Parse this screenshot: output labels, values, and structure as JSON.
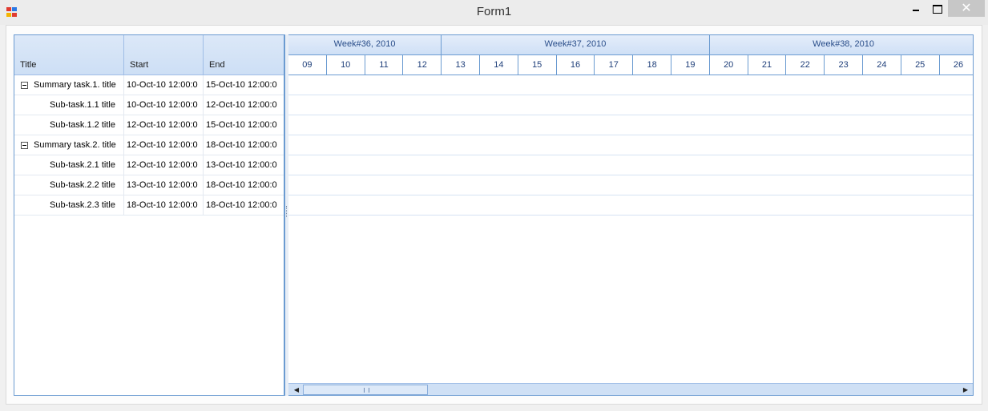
{
  "window": {
    "title": "Form1",
    "close_glyph": "✕"
  },
  "grid": {
    "columns": [
      "Title",
      "Start",
      "End"
    ],
    "rows": [
      {
        "title": "Summary task.1. title",
        "start": "10-Oct-10 12:00:0",
        "end": "15-Oct-10 12:00:0",
        "summary": true
      },
      {
        "title": "Sub-task.1.1 title",
        "start": "10-Oct-10 12:00:0",
        "end": "12-Oct-10 12:00:0",
        "summary": false
      },
      {
        "title": "Sub-task.1.2 title",
        "start": "12-Oct-10 12:00:0",
        "end": "15-Oct-10 12:00:0",
        "summary": false
      },
      {
        "title": "Summary task.2. title",
        "start": "12-Oct-10 12:00:0",
        "end": "18-Oct-10 12:00:0",
        "summary": true
      },
      {
        "title": "Sub-task.2.1 title",
        "start": "12-Oct-10 12:00:0",
        "end": "13-Oct-10 12:00:0",
        "summary": false
      },
      {
        "title": "Sub-task.2.2 title",
        "start": "13-Oct-10 12:00:0",
        "end": "18-Oct-10 12:00:0",
        "summary": false
      },
      {
        "title": "Sub-task.2.3 title",
        "start": "18-Oct-10 12:00:0",
        "end": "18-Oct-10 12:00:0",
        "summary": false
      }
    ]
  },
  "timeline": {
    "weeks": [
      "Week#36, 2010",
      "Week#37, 2010",
      "Week#38, 2010"
    ],
    "days": [
      "09",
      "10",
      "11",
      "12",
      "13",
      "14",
      "15",
      "16",
      "17",
      "18",
      "19",
      "20",
      "21",
      "22",
      "23",
      "24",
      "25",
      "26"
    ],
    "week_day_counts": [
      4,
      7,
      7
    ]
  },
  "scrollbar": {
    "left_arrow": "◀",
    "right_arrow": "▶"
  },
  "colors": {
    "accent": "#6b9bd1",
    "header": "#cddff5"
  }
}
